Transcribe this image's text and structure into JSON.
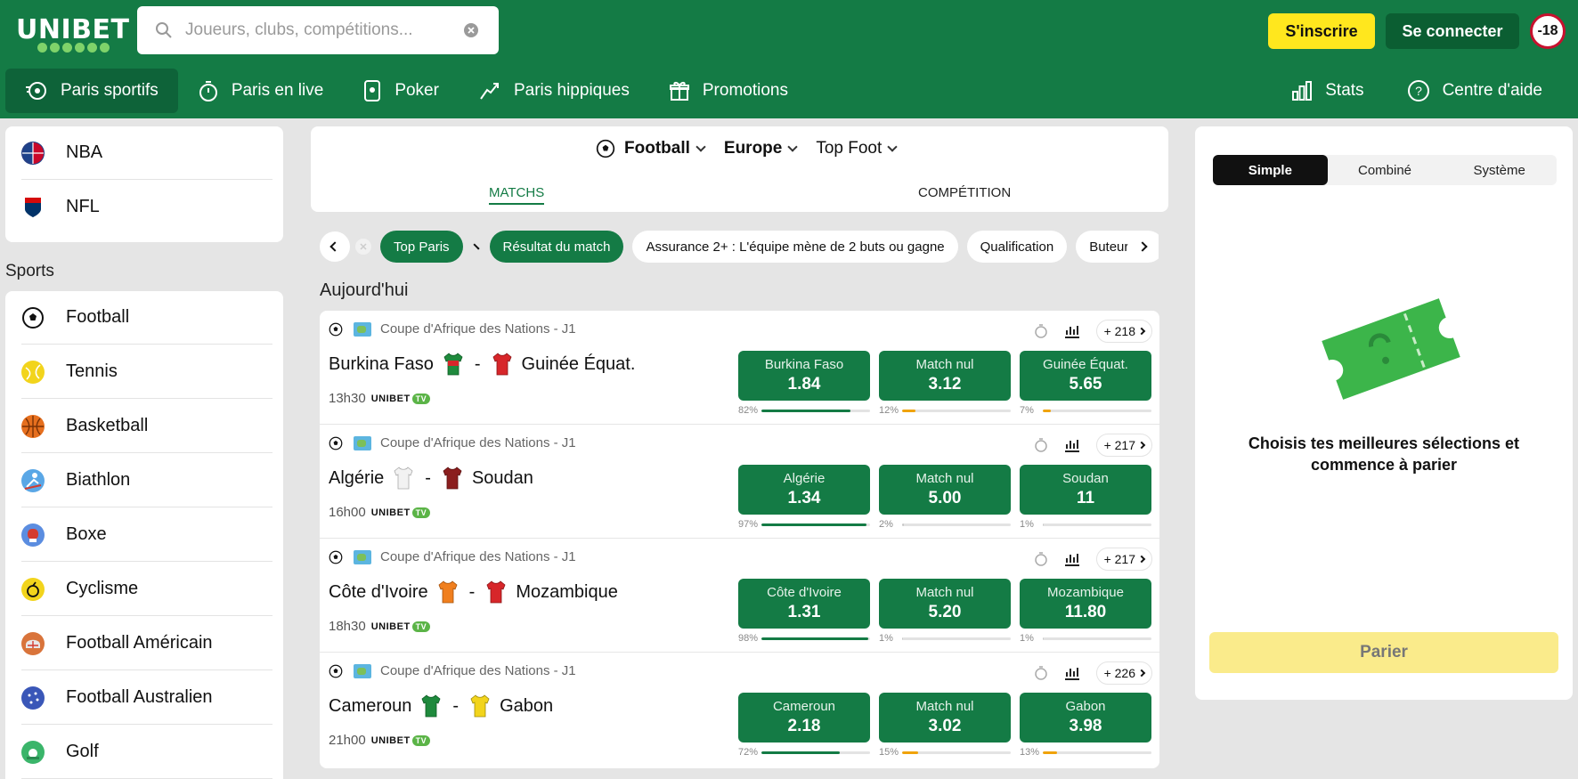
{
  "header": {
    "logo": "UNIBET",
    "search_placeholder": "Joueurs, clubs, compétitions...",
    "register_label": "S'inscrire",
    "login_label": "Se connecter",
    "age_label": "-18"
  },
  "nav": {
    "items": [
      {
        "label": "Paris sportifs",
        "icon": "sports-bet-icon",
        "active": true
      },
      {
        "label": "Paris en live",
        "icon": "stopwatch-icon"
      },
      {
        "label": "Poker",
        "icon": "poker-card-icon"
      },
      {
        "label": "Paris hippiques",
        "icon": "horse-icon"
      },
      {
        "label": "Promotions",
        "icon": "gift-icon"
      }
    ],
    "right": [
      {
        "label": "Stats",
        "icon": "stats-icon"
      },
      {
        "label": "Centre d'aide",
        "icon": "help-icon"
      }
    ]
  },
  "sidebar": {
    "top_items": [
      {
        "label": "NBA",
        "icon": "nba-icon"
      },
      {
        "label": "NFL",
        "icon": "nfl-icon"
      }
    ],
    "sports_title": "Sports",
    "sports": [
      {
        "label": "Football",
        "icon": "football-icon",
        "color": "#ffffff"
      },
      {
        "label": "Tennis",
        "icon": "tennis-icon",
        "color": "#f2d41c"
      },
      {
        "label": "Basketball",
        "icon": "basketball-icon",
        "color": "#e66f1e"
      },
      {
        "label": "Biathlon",
        "icon": "biathlon-icon",
        "color": "#5aa7e6"
      },
      {
        "label": "Boxe",
        "icon": "boxing-icon",
        "color": "#d43b2f"
      },
      {
        "label": "Cyclisme",
        "icon": "cycling-icon",
        "color": "#f2d41c"
      },
      {
        "label": "Football Américain",
        "icon": "american-football-icon",
        "color": "#d9743b"
      },
      {
        "label": "Football Australien",
        "icon": "australian-football-icon",
        "color": "#3a57b8"
      },
      {
        "label": "Golf",
        "icon": "golf-icon",
        "color": "#3ab56a"
      }
    ]
  },
  "filters": {
    "sport": "Football",
    "region": "Europe",
    "league": "Top Foot",
    "tab_matchs": "MATCHS",
    "tab_competition": "COMPÉTITION",
    "chips": [
      "Top Paris",
      "Résultat du match",
      "Assurance 2+ : L'équipe mène de 2 buts ou gagne",
      "Qualification",
      "Buteur"
    ]
  },
  "today_label": "Aujourd'hui",
  "matches": [
    {
      "competition": "Coupe d'Afrique des Nations - J1",
      "more": "+ 218",
      "home": "Burkina Faso",
      "away": "Guinée Équat.",
      "home_color": "#1f8a3d",
      "away_color": "#d7262a",
      "time": "13h30",
      "odds": [
        {
          "label": "Burkina Faso",
          "value": "1.84",
          "pct": "82%",
          "fill": 0.82,
          "color": "#147b45"
        },
        {
          "label": "Match nul",
          "value": "3.12",
          "pct": "12%",
          "fill": 0.12,
          "color": "#f0a30a"
        },
        {
          "label": "Guinée Équat.",
          "value": "5.65",
          "pct": "7%",
          "fill": 0.07,
          "color": "#f0a30a"
        }
      ]
    },
    {
      "competition": "Coupe d'Afrique des Nations - J1",
      "more": "+ 217",
      "home": "Algérie",
      "away": "Soudan",
      "home_color": "#f2f2f2",
      "away_color": "#8b1e1e",
      "time": "16h00",
      "odds": [
        {
          "label": "Algérie",
          "value": "1.34",
          "pct": "97%",
          "fill": 0.97,
          "color": "#147b45"
        },
        {
          "label": "Match nul",
          "value": "5.00",
          "pct": "2%",
          "fill": 0.02,
          "color": "#c8c8c8"
        },
        {
          "label": "Soudan",
          "value": "11",
          "pct": "1%",
          "fill": 0.01,
          "color": "#c8c8c8"
        }
      ]
    },
    {
      "competition": "Coupe d'Afrique des Nations - J1",
      "more": "+ 217",
      "home": "Côte d'Ivoire",
      "away": "Mozambique",
      "home_color": "#f07f1e",
      "away_color": "#d7262a",
      "time": "18h30",
      "odds": [
        {
          "label": "Côte d'Ivoire",
          "value": "1.31",
          "pct": "98%",
          "fill": 0.98,
          "color": "#147b45"
        },
        {
          "label": "Match nul",
          "value": "5.20",
          "pct": "1%",
          "fill": 0.01,
          "color": "#c8c8c8"
        },
        {
          "label": "Mozambique",
          "value": "11.80",
          "pct": "1%",
          "fill": 0.01,
          "color": "#c8c8c8"
        }
      ]
    },
    {
      "competition": "Coupe d'Afrique des Nations - J1",
      "more": "+ 226",
      "home": "Cameroun",
      "away": "Gabon",
      "home_color": "#1f8a3d",
      "away_color": "#f2d41c",
      "time": "21h00",
      "odds": [
        {
          "label": "Cameroun",
          "value": "2.18",
          "pct": "72%",
          "fill": 0.72,
          "color": "#147b45"
        },
        {
          "label": "Match nul",
          "value": "3.02",
          "pct": "15%",
          "fill": 0.15,
          "color": "#f0a30a"
        },
        {
          "label": "Gabon",
          "value": "3.98",
          "pct": "13%",
          "fill": 0.13,
          "color": "#f0a30a"
        }
      ]
    }
  ],
  "tv_label": "UNIBET",
  "tv_badge": "TV",
  "betslip": {
    "tabs": [
      "Simple",
      "Combiné",
      "Système"
    ],
    "message": "Choisis tes meilleures sélections et commence à parier",
    "button": "Parier"
  },
  "colors": {
    "brand": "#147b45",
    "accent": "#ffe71e"
  }
}
